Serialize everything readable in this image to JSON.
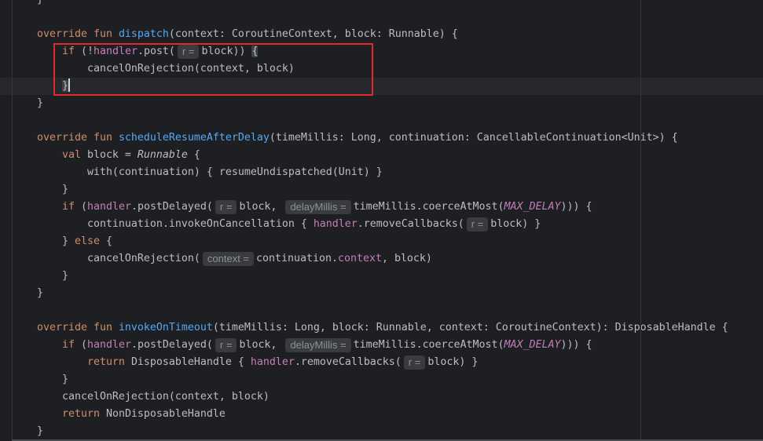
{
  "colors": {
    "background": "#1e1f22",
    "text": "#bcbec4",
    "keyword": "#cf8e6d",
    "function": "#56a8f5",
    "property": "#c77dbb",
    "hint_background": "#393b40",
    "hint_text": "#8d9096",
    "current_line": "#26282e",
    "annotation_box": "#e0282d",
    "caret": "#ced0d6",
    "brace_match": "#3f4247"
  },
  "code_lines": [
    {
      "tokens": [
        {
          "t": "    }",
          "c": "tx"
        }
      ]
    },
    {
      "tokens": []
    },
    {
      "tokens": [
        {
          "t": "    ",
          "c": "tx"
        },
        {
          "t": "override fun ",
          "c": "kw"
        },
        {
          "t": "dispatch",
          "c": "fn"
        },
        {
          "t": "(context: CoroutineContext, block: Runnable) {",
          "c": "tx"
        }
      ]
    },
    {
      "tokens": [
        {
          "t": "        ",
          "c": "tx"
        },
        {
          "t": "if ",
          "c": "kw"
        },
        {
          "t": "(!",
          "c": "tx"
        },
        {
          "t": "handler",
          "c": "prop"
        },
        {
          "t": ".post(",
          "c": "tx"
        },
        {
          "t": "r =",
          "c": "hint"
        },
        {
          "t": "block)) ",
          "c": "tx"
        },
        {
          "t": "{",
          "c": "brace"
        }
      ]
    },
    {
      "tokens": [
        {
          "t": "            cancelOnRejection(context, block)",
          "c": "tx"
        }
      ]
    },
    {
      "current": true,
      "tokens": [
        {
          "t": "        ",
          "c": "tx"
        },
        {
          "t": "}",
          "c": "brace"
        },
        {
          "c": "caret"
        }
      ]
    },
    {
      "tokens": [
        {
          "t": "    }",
          "c": "tx"
        }
      ]
    },
    {
      "tokens": []
    },
    {
      "tokens": [
        {
          "t": "    ",
          "c": "tx"
        },
        {
          "t": "override fun ",
          "c": "kw"
        },
        {
          "t": "scheduleResumeAfterDelay",
          "c": "fn"
        },
        {
          "t": "(timeMillis: Long, continuation: CancellableContinuation<Unit>) {",
          "c": "tx"
        }
      ]
    },
    {
      "tokens": [
        {
          "t": "        ",
          "c": "tx"
        },
        {
          "t": "val ",
          "c": "kw"
        },
        {
          "t": "block = ",
          "c": "tx"
        },
        {
          "t": "Runnable",
          "c": "ital"
        },
        {
          "t": " {",
          "c": "tx"
        }
      ]
    },
    {
      "tokens": [
        {
          "t": "            with(continuation) { resumeUndispatched(Unit) }",
          "c": "tx"
        }
      ]
    },
    {
      "tokens": [
        {
          "t": "        }",
          "c": "tx"
        }
      ]
    },
    {
      "tokens": [
        {
          "t": "        ",
          "c": "tx"
        },
        {
          "t": "if ",
          "c": "kw"
        },
        {
          "t": "(",
          "c": "tx"
        },
        {
          "t": "handler",
          "c": "prop"
        },
        {
          "t": ".postDelayed(",
          "c": "tx"
        },
        {
          "t": "r =",
          "c": "hint"
        },
        {
          "t": "block, ",
          "c": "tx"
        },
        {
          "t": "delayMillis =",
          "c": "hint"
        },
        {
          "t": "timeMillis.coerceAtMost(",
          "c": "tx"
        },
        {
          "t": "MAX_DELAY",
          "c": "const"
        },
        {
          "t": "))) {",
          "c": "tx"
        }
      ]
    },
    {
      "tokens": [
        {
          "t": "            continuation.invokeOnCancellation { ",
          "c": "tx"
        },
        {
          "t": "handler",
          "c": "prop"
        },
        {
          "t": ".removeCallbacks(",
          "c": "tx"
        },
        {
          "t": "r =",
          "c": "hint"
        },
        {
          "t": "block) }",
          "c": "tx"
        }
      ]
    },
    {
      "tokens": [
        {
          "t": "        } ",
          "c": "tx"
        },
        {
          "t": "else",
          "c": "kw"
        },
        {
          "t": " {",
          "c": "tx"
        }
      ]
    },
    {
      "tokens": [
        {
          "t": "            cancelOnRejection(",
          "c": "tx"
        },
        {
          "t": "context =",
          "c": "hint"
        },
        {
          "t": "continuation.",
          "c": "tx"
        },
        {
          "t": "context",
          "c": "prop"
        },
        {
          "t": ", block)",
          "c": "tx"
        }
      ]
    },
    {
      "tokens": [
        {
          "t": "        }",
          "c": "tx"
        }
      ]
    },
    {
      "tokens": [
        {
          "t": "    }",
          "c": "tx"
        }
      ]
    },
    {
      "tokens": []
    },
    {
      "tokens": [
        {
          "t": "    ",
          "c": "tx"
        },
        {
          "t": "override fun ",
          "c": "kw"
        },
        {
          "t": "invokeOnTimeout",
          "c": "fn"
        },
        {
          "t": "(timeMillis: Long, block: Runnable, context: CoroutineContext): DisposableHandle {",
          "c": "tx"
        }
      ]
    },
    {
      "tokens": [
        {
          "t": "        ",
          "c": "tx"
        },
        {
          "t": "if ",
          "c": "kw"
        },
        {
          "t": "(",
          "c": "tx"
        },
        {
          "t": "handler",
          "c": "prop"
        },
        {
          "t": ".postDelayed(",
          "c": "tx"
        },
        {
          "t": "r =",
          "c": "hint"
        },
        {
          "t": "block, ",
          "c": "tx"
        },
        {
          "t": "delayMillis =",
          "c": "hint"
        },
        {
          "t": "timeMillis.coerceAtMost(",
          "c": "tx"
        },
        {
          "t": "MAX_DELAY",
          "c": "const"
        },
        {
          "t": "))) {",
          "c": "tx"
        }
      ]
    },
    {
      "tokens": [
        {
          "t": "            ",
          "c": "tx"
        },
        {
          "t": "return ",
          "c": "kw"
        },
        {
          "t": "DisposableHandle { ",
          "c": "tx"
        },
        {
          "t": "handler",
          "c": "prop"
        },
        {
          "t": ".removeCallbacks(",
          "c": "tx"
        },
        {
          "t": "r =",
          "c": "hint"
        },
        {
          "t": "block) }",
          "c": "tx"
        }
      ]
    },
    {
      "tokens": [
        {
          "t": "        }",
          "c": "tx"
        }
      ]
    },
    {
      "tokens": [
        {
          "t": "        cancelOnRejection(context, block)",
          "c": "tx"
        }
      ]
    },
    {
      "tokens": [
        {
          "t": "        ",
          "c": "tx"
        },
        {
          "t": "return ",
          "c": "kw"
        },
        {
          "t": "NonDisposableHandle",
          "c": "tx"
        }
      ]
    },
    {
      "tokens": [
        {
          "t": "    }",
          "c": "tx"
        }
      ]
    }
  ]
}
